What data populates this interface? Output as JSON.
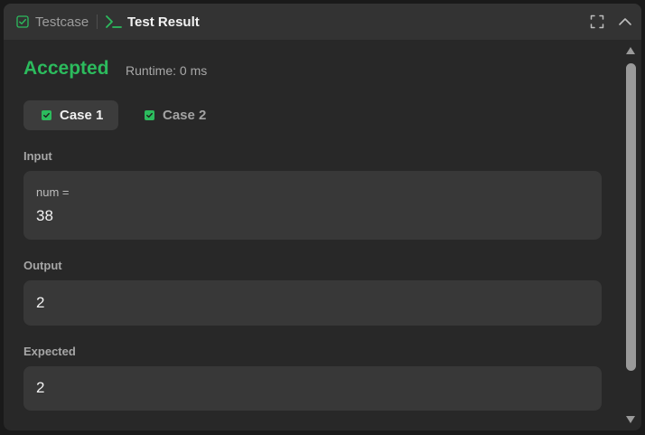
{
  "header": {
    "testcase_label": "Testcase",
    "result_label": "Test Result",
    "icons": {
      "testcase": "checkbox-icon",
      "result": "terminal-icon",
      "fullscreen": "fullscreen-icon",
      "collapse": "chevron-up-icon"
    }
  },
  "result": {
    "status": "Accepted",
    "runtime": "Runtime: 0 ms"
  },
  "cases": [
    {
      "label": "Case 1",
      "active": true
    },
    {
      "label": "Case 2",
      "active": false
    }
  ],
  "input": {
    "label": "Input",
    "var_name": "num =",
    "value": "38"
  },
  "output": {
    "label": "Output",
    "value": "2"
  },
  "expected": {
    "label": "Expected",
    "value": "2"
  },
  "colors": {
    "accent_green": "#2cbb5d",
    "panel_bg": "#282828",
    "header_bg": "#333333",
    "box_bg": "#383838"
  }
}
